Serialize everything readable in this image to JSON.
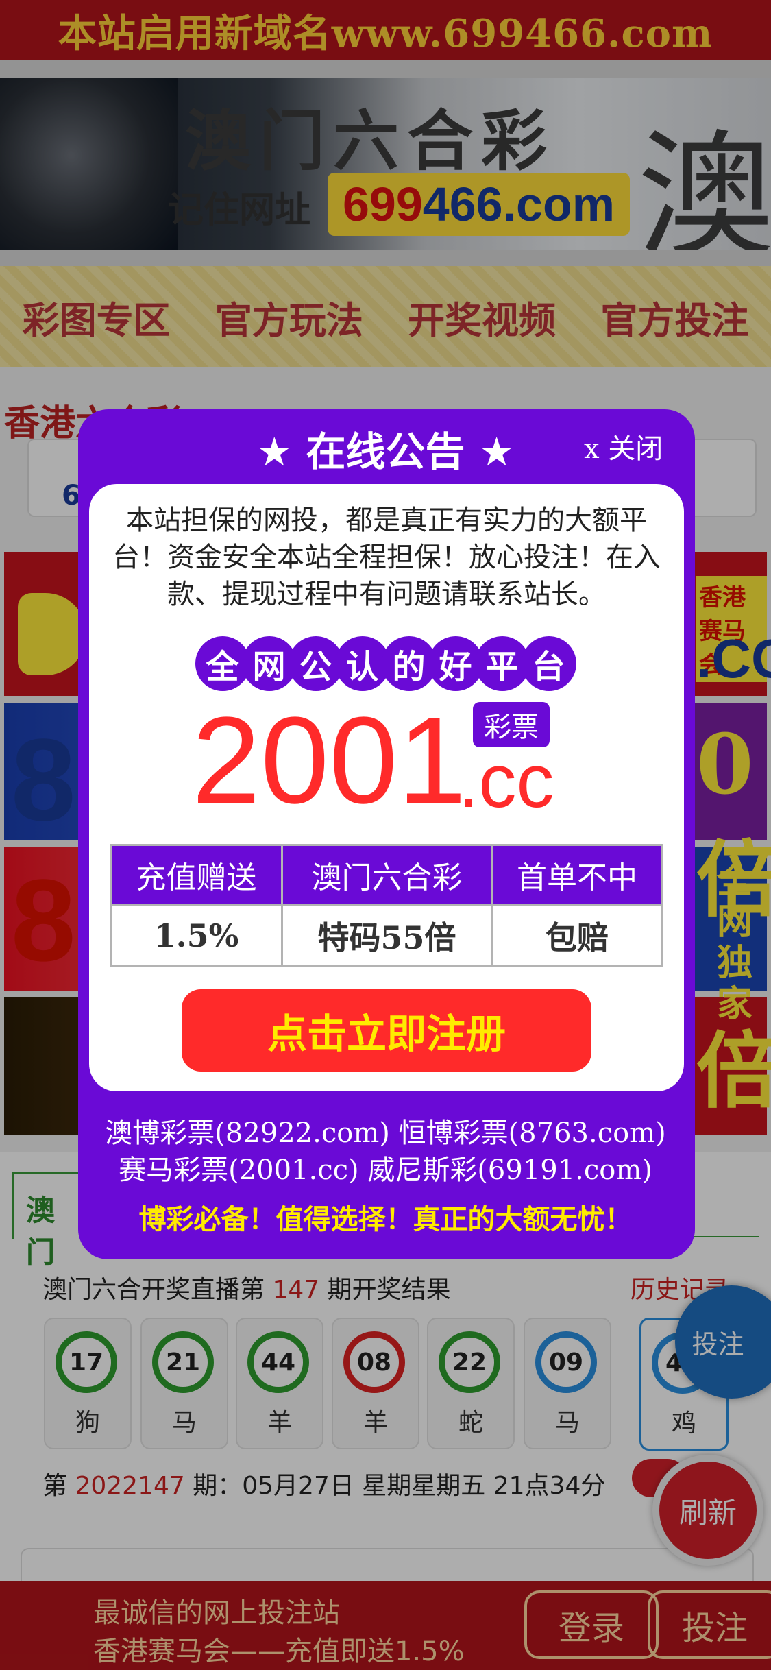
{
  "topbar": {
    "text": "本站启用新域名www.699466.com"
  },
  "banner": {
    "title": "澳门六合彩",
    "sub": "记住网址",
    "url_a": "699",
    "url_b": "466.com",
    "big_char": "澳"
  },
  "nav": {
    "items": [
      "彩图专区",
      "官方玩法",
      "开奖视频",
      "官方投注"
    ]
  },
  "bg": {
    "hk_title": "香港六合彩",
    "hk_num": "6",
    "ad2_left": "87",
    "ad3_left": "829",
    "ad1_right_a": "香港赛马会",
    "ad1_right_b": ".CC",
    "ad2_right": "0倍",
    "ad3_right": "全网独家",
    "ad4_right": "倍"
  },
  "results": {
    "tab": "澳门",
    "head_prefix": "澳门六合开奖直播第 ",
    "period": "147",
    "head_suffix": " 期开奖结果",
    "history": "历史记录",
    "balls": [
      {
        "num": "17",
        "zodiac": "狗",
        "color": "green"
      },
      {
        "num": "21",
        "zodiac": "马",
        "color": "green"
      },
      {
        "num": "44",
        "zodiac": "羊",
        "color": "green"
      },
      {
        "num": "08",
        "zodiac": "羊",
        "color": "red"
      },
      {
        "num": "22",
        "zodiac": "蛇",
        "color": "green"
      },
      {
        "num": "09",
        "zodiac": "马",
        "color": "blue"
      },
      {
        "num": "42",
        "zodiac": "鸡",
        "color": "blue"
      }
    ],
    "date_prefix": "第 ",
    "date_period": "2022147",
    "date_suffix": " 期：05月27日 星期星期五 21点34分"
  },
  "float": {
    "bet": "投注",
    "refresh": "刷新"
  },
  "bottom": {
    "line1": "最诚信的网上投注站",
    "line2": "香港赛马会——充值即送1.5%",
    "login": "登录",
    "bet": "投注"
  },
  "modal": {
    "title": "★ 在线公告 ★",
    "close": "x 关闭",
    "notice": "本站担保的网投，都是真正有实力的大额平台！资金安全本站全程担保！放心投注！在入款、提现过程中有问题请联系站长。",
    "pills": [
      "全",
      "网",
      "公",
      "认",
      "的",
      "好",
      "平",
      "台"
    ],
    "tag": "彩票",
    "big_number": "2001",
    "big_suffix": ".cc",
    "table_head": [
      "充值赠送",
      "澳门六合彩",
      "首单不中"
    ],
    "table_body": [
      "1.5%",
      "特码55倍",
      "包赔"
    ],
    "register": "点击立即注册",
    "links1": "澳博彩票(82922.com) 恒博彩票(8763.com)",
    "links2": "赛马彩票(2001.cc) 威尼斯彩(69191.com)",
    "slogan": "博彩必备！值得选择！真正的大额无忧！"
  },
  "colors": {
    "brand_red": "#b3141b",
    "modal_purple": "#6a0ad6",
    "accent_yellow": "#ffeb00",
    "number_red": "#ff2a2a"
  }
}
